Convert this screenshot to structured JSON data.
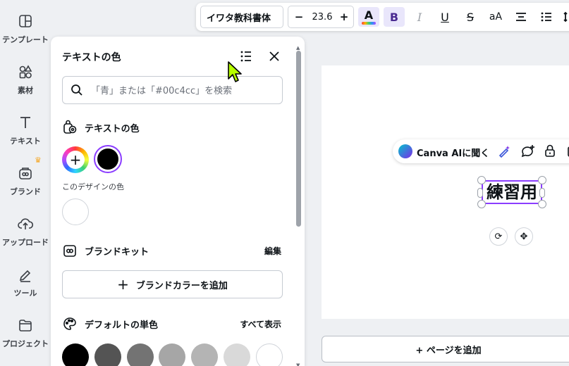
{
  "rail": {
    "items": [
      {
        "label": "テンプレート",
        "icon": "template-icon"
      },
      {
        "label": "素材",
        "icon": "elements-icon"
      },
      {
        "label": "テキスト",
        "icon": "text-icon"
      },
      {
        "label": "ブランド",
        "icon": "brand-icon"
      },
      {
        "label": "アップロード",
        "icon": "upload-icon"
      },
      {
        "label": "ツール",
        "icon": "tools-icon"
      },
      {
        "label": "プロジェクト",
        "icon": "folder-icon"
      }
    ]
  },
  "toolbar": {
    "font": "イワタ教科書体",
    "size_minus": "−",
    "size": "23.6",
    "size_plus": "+",
    "color_letter": "A",
    "bold": "B",
    "italic": "I",
    "underline": "U",
    "strike": "S",
    "case": "aA"
  },
  "panel": {
    "title": "テキストの色",
    "search_placeholder": "「青」または「#00c4cc」を検索",
    "text_colors_heading": "テキストの色",
    "design_colors_label": "このデザインの色",
    "brand_kit_heading": "ブランドキット",
    "brand_kit_edit": "編集",
    "add_brand_color": "ブランドカラーを追加",
    "default_heading": "デフォルトの単色",
    "show_all": "すべて表示",
    "default_colors": [
      "#000000",
      "#545454",
      "#737373",
      "#a6a6a6",
      "#b4b4b4",
      "#d9d9d9",
      "#ffffff"
    ],
    "current_color": "#000000"
  },
  "canvas": {
    "selected_text": "練習用",
    "ai_label": "Canva AIに聞く",
    "add_page": "+ ページを追加"
  },
  "colors": {
    "accent": "#8b3dff"
  }
}
